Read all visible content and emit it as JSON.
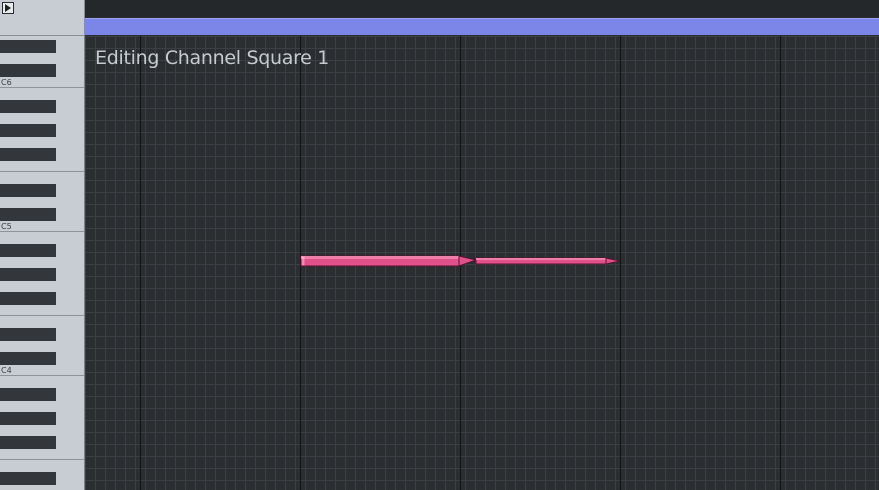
{
  "editor": {
    "title": "Editing Channel Square 1",
    "octave_labels": [
      "C6",
      "C5",
      "C4"
    ]
  },
  "transport": {
    "play_icon": "play-icon"
  },
  "colors": {
    "background": "#2b2e31",
    "grid_line": "#3c4044",
    "beat_line": "#111315",
    "loop_bar": "#7b86e8",
    "piano_white": "#c7cdd3",
    "piano_black": "#33373b",
    "note_fill": "#e0508a",
    "note_outline": "#5a1030"
  }
}
